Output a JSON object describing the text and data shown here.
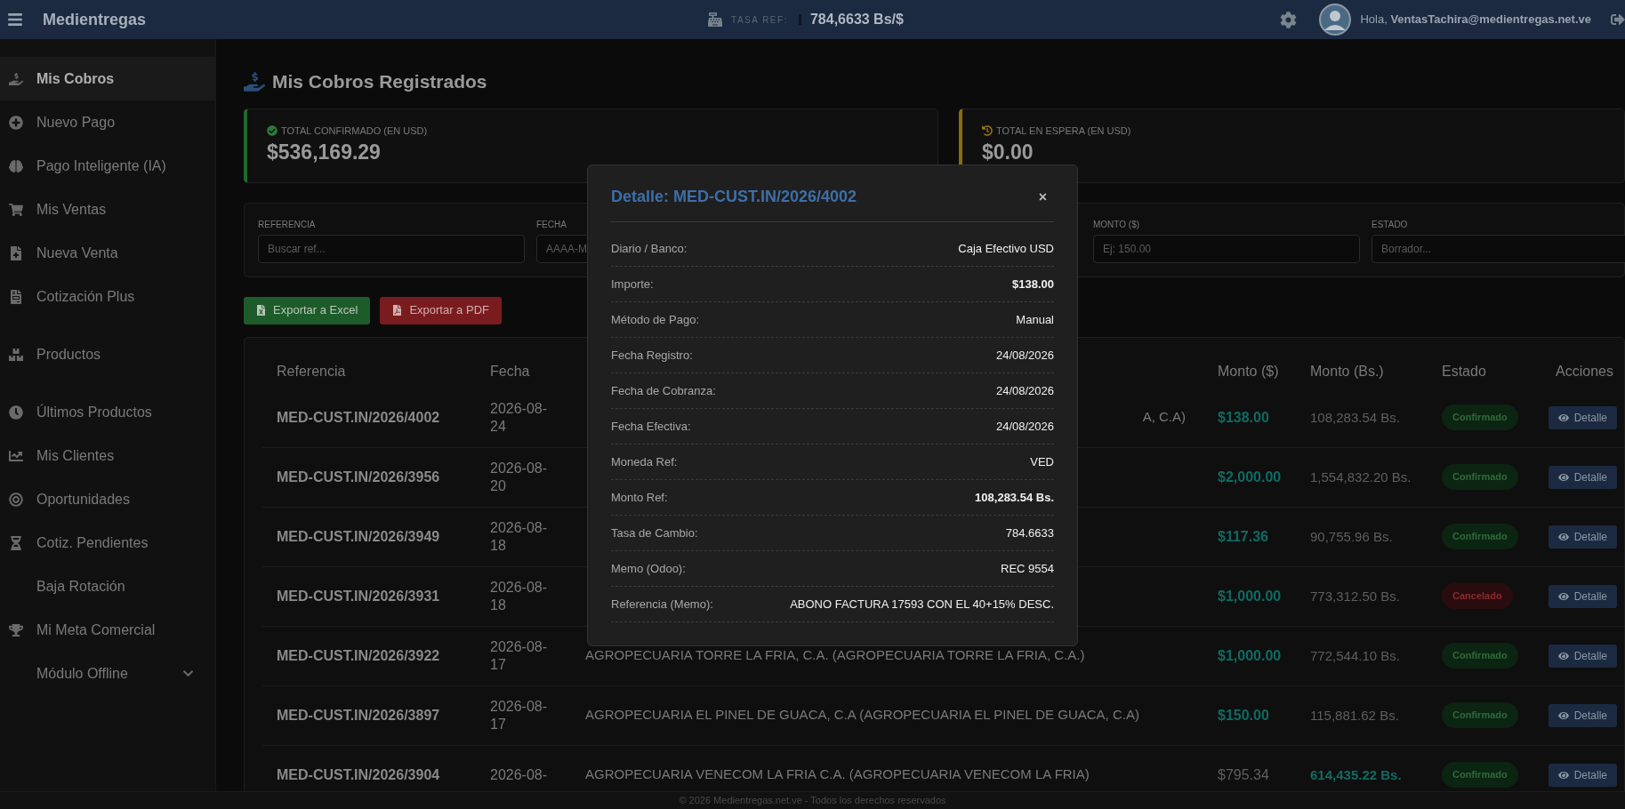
{
  "header": {
    "brand": "Medientregas",
    "rate_label": "TASA REF:",
    "rate_value": "784,6633 Bs/$",
    "greeting": "Hola, **VentasTachira@medientregas.net.ve**"
  },
  "sidebar": {
    "sections": [
      [
        {
          "label": "Mis Cobros",
          "selected": true,
          "expandable": false
        },
        {
          "label": "Nuevo Pago",
          "selected": false,
          "expandable": false
        },
        {
          "label": "Pago Inteligente (IA)",
          "selected": false,
          "expandable": false
        },
        {
          "label": "Mis Ventas",
          "selected": false,
          "expandable": false
        },
        {
          "label": "Nueva Venta",
          "selected": false,
          "expandable": false
        },
        {
          "label": "Cotización Plus",
          "selected": false,
          "expandable": false
        }
      ],
      [
        {
          "label": "Productos",
          "selected": false,
          "expandable": false
        }
      ],
      [
        {
          "label": "Últimos Productos",
          "selected": false,
          "expandable": false
        },
        {
          "label": "Mis Clientes",
          "selected": false,
          "expandable": false
        },
        {
          "label": "Oportunidades",
          "selected": false,
          "expandable": false
        },
        {
          "label": "Cotiz. Pendientes",
          "selected": false,
          "expandable": false
        },
        {
          "label": "Baja Rotación",
          "selected": false,
          "expandable": false
        },
        {
          "label": "Mi Meta Comercial",
          "selected": false,
          "expandable": false
        },
        {
          "label": "Módulo Offline",
          "selected": false,
          "expandable": true
        }
      ]
    ]
  },
  "page_title": "Mis Cobros Registrados",
  "summary_cards": [
    {
      "label": "TOTAL CONFIRMADO (EN USD)",
      "value": "$536,169.29",
      "kind": "confirmed"
    },
    {
      "label": "TOTAL EN ESPERA (EN USD)",
      "value": "$0.00",
      "kind": "pending"
    }
  ],
  "filters": [
    {
      "label": "REFERENCIA",
      "placeholder": "Buscar ref...",
      "kind": "input"
    },
    {
      "label": "FECHA",
      "placeholder": "AAAA-M",
      "kind": "input"
    },
    {
      "kind": "hidden"
    },
    {
      "label": "MONTO ($)",
      "placeholder": "Ej: 150.00",
      "kind": "input"
    },
    {
      "label": "ESTADO",
      "placeholder": "Borrador...",
      "kind": "select"
    }
  ],
  "export_buttons": [
    {
      "label": "Exportar a Excel",
      "kind": "excel"
    },
    {
      "label": "Exportar a PDF",
      "kind": "pdf"
    }
  ],
  "table": {
    "columns": [
      "Referencia",
      "Fecha",
      "Monto ($)",
      "Monto (Bs.)",
      "Estado",
      "Acciones"
    ],
    "rows": [
      {
        "reference": "MED-CUST.IN/2026/4002",
        "date": "2026-08-24",
        "client_tail": "A, C.A)",
        "amount_usd": "$138.00",
        "amount_bs": "108,283.54 Bs.",
        "usd_highlighted": true,
        "status": {
          "label": "Confirmado",
          "kind": "confirmed"
        },
        "action": "Detalle"
      },
      {
        "reference": "MED-CUST.IN/2026/3956",
        "date": "2026-08-20",
        "amount_usd": "$2,000.00",
        "amount_bs": "1,554,832.20 Bs.",
        "usd_highlighted": true,
        "status": {
          "label": "Confirmado",
          "kind": "confirmed"
        },
        "action": "Detalle"
      },
      {
        "reference": "MED-CUST.IN/2026/3949",
        "date": "2026-08-18",
        "amount_usd": "$117.36",
        "amount_bs": "90,755.96 Bs.",
        "usd_highlighted": true,
        "status": {
          "label": "Confirmado",
          "kind": "confirmed"
        },
        "action": "Detalle"
      },
      {
        "reference": "MED-CUST.IN/2026/3931",
        "date": "2026-08-18",
        "amount_usd": "$1,000.00",
        "amount_bs": "773,312.50 Bs.",
        "usd_highlighted": true,
        "status": {
          "label": "Cancelado",
          "kind": "cancelled"
        },
        "action": "Detalle"
      },
      {
        "reference": "MED-CUST.IN/2026/3922",
        "date": "2026-08-17",
        "client": "AGROPECUARIA TORRE LA FRIA, C.A. (AGROPECUARIA TORRE LA FRIA, C.A.)",
        "amount_usd": "$1,000.00",
        "amount_bs": "772,544.10 Bs.",
        "usd_highlighted": true,
        "status": {
          "label": "Confirmado",
          "kind": "confirmed"
        },
        "action": "Detalle"
      },
      {
        "reference": "MED-CUST.IN/2026/3897",
        "date": "2026-08-17",
        "client": "AGROPECUARIA EL PINEL DE GUACA, C.A (AGROPECUARIA EL PINEL DE GUACA, C.A)",
        "amount_usd": "$150.00",
        "amount_bs": "115,881.62 Bs.",
        "usd_highlighted": true,
        "status": {
          "label": "Confirmado",
          "kind": "confirmed"
        },
        "action": "Detalle"
      },
      {
        "reference": "MED-CUST.IN/2026/3904",
        "date": "2026-08-",
        "client": "AGROPECUARIA VENECOM LA FRIA C.A. (AGROPECUARIA VENECOM LA FRIA)",
        "amount_usd": "$795.34",
        "amount_bs": "614,435.22 Bs.",
        "usd_highlighted": false,
        "status": {
          "label": "Confirmado",
          "kind": "confirmed"
        },
        "action": "Detalle"
      }
    ]
  },
  "modal": {
    "title": "Detalle: MED-CUST.IN/2026/4002",
    "close": "×",
    "fields": [
      {
        "label": "Diario / Banco:",
        "value": "Caja Efectivo USD",
        "bold": false
      },
      {
        "label": "Importe:",
        "value": "$138.00",
        "bold": true
      },
      {
        "label": "Método de Pago:",
        "value": "Manual",
        "bold": false
      },
      {
        "label": "Fecha Registro:",
        "value": "24/08/2026",
        "bold": false
      },
      {
        "label": "Fecha de Cobranza:",
        "value": "24/08/2026",
        "bold": false
      },
      {
        "label": "Fecha Efectiva:",
        "value": "24/08/2026",
        "bold": false
      },
      {
        "label": "Moneda Ref:",
        "value": "VED",
        "bold": false
      },
      {
        "label": "Monto Ref:",
        "value": "108,283.54 Bs.",
        "bold": true
      },
      {
        "label": "Tasa de Cambio:",
        "value": "784.6633",
        "bold": false
      },
      {
        "label": "Memo (Odoo):",
        "value": "REC 9554",
        "bold": false
      },
      {
        "label": "Referencia (Memo):",
        "value": "ABONO FACTURA 17593 CON EL 40+15% DESC.",
        "bold": false
      }
    ]
  },
  "footer": "© 2026 Medientregas.net.ve - Todos los derechos reservados"
}
